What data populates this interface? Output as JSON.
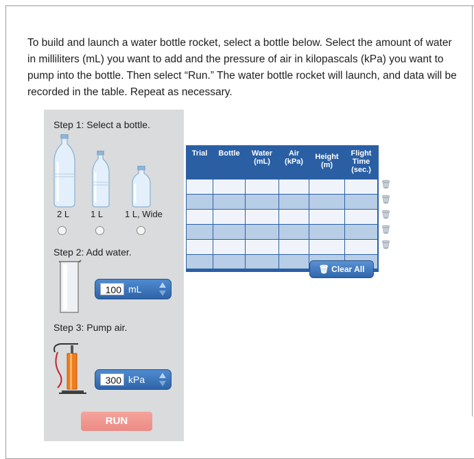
{
  "instructions": "To build and launch a water bottle rocket, select a bottle below. Select the amount of water in milliliters (mL) you want to add and the pressure of air in kilopascals (kPa) you want to pump into the bottle. Then select “Run.” The water bottle rocket will launch, and data will be recorded in the table. Repeat as necessary.",
  "step1": {
    "label": "Step 1: Select a bottle.",
    "bottles": [
      {
        "label": "2 L",
        "selected": false
      },
      {
        "label": "1 L",
        "selected": false
      },
      {
        "label": "1 L, Wide",
        "selected": false
      }
    ]
  },
  "step2": {
    "label": "Step 2: Add water.",
    "value": "100",
    "unit": "mL"
  },
  "step3": {
    "label": "Step 3: Pump air.",
    "value": "300",
    "unit": "kPa"
  },
  "run_label": "RUN",
  "table": {
    "headers": [
      [
        "Trial"
      ],
      [
        "Bottle"
      ],
      [
        "Water",
        "(mL)"
      ],
      [
        "Air",
        "(kPa)"
      ],
      [
        "Height",
        "(m)"
      ],
      [
        "Flight",
        "Time",
        "(sec.)"
      ]
    ],
    "rows": [
      [],
      [],
      [],
      [],
      []
    ],
    "clear_label": "Clear All"
  },
  "icons": {
    "trash": "trash-icon",
    "spinner": "up-down-arrows-icon"
  },
  "colors": {
    "table_header": "#2a5fa4",
    "row_light": "#f0f4fa",
    "row_dark": "#b8cde6",
    "run_button": "#ec8b85"
  }
}
